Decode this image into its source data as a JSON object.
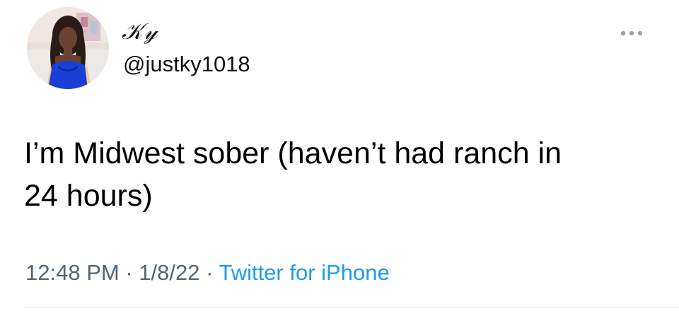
{
  "tweet": {
    "author": {
      "display_name": "𝒦𝓎",
      "handle": "@justky1018"
    },
    "text": "I’m Midwest sober (haven’t had ranch in\n24 hours)",
    "time": "12:48 PM",
    "separator": " · ",
    "date": "1/8/22",
    "source": "Twitter for iPhone",
    "more_icon": "more-horizontal-icon"
  },
  "colors": {
    "text_primary": "#0f1419",
    "text_secondary": "#536471",
    "link": "#1d9bf0",
    "divider": "#e1e6ea",
    "avatar_dress": "#1a3fd6"
  }
}
